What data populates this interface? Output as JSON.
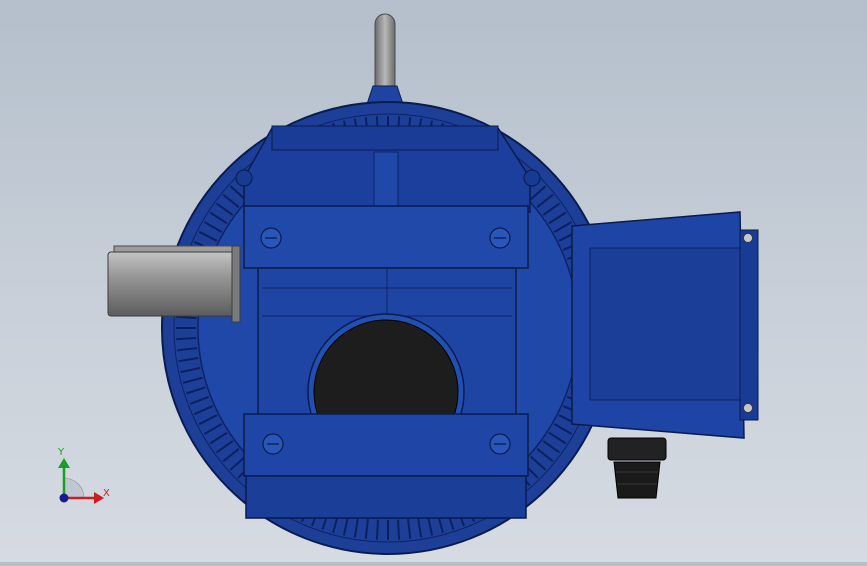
{
  "viewport": {
    "background_top": "#b4bfcb",
    "background_bottom": "#d6dbe2",
    "model_color": "#1e43a0",
    "model_dark": "#0f2a78",
    "shaft_color": "#8a8a8a",
    "bore_color": "#1c1c1c",
    "gland_color": "#1a1a1a"
  },
  "triad": {
    "x_label": "X",
    "y_label": "Y",
    "x_color": "#cc1e1e",
    "y_color": "#1e9b2e",
    "z_color": "#1a1a8c"
  }
}
